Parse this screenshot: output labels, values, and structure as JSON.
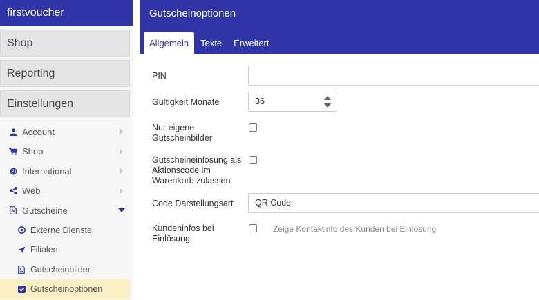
{
  "app": {
    "brand": "firstvoucher"
  },
  "sidebar": {
    "sections": [
      "Shop",
      "Reporting",
      "Einstellungen"
    ],
    "items": [
      {
        "label": "Account",
        "icon": "user-icon"
      },
      {
        "label": "Shop",
        "icon": "cart-icon"
      },
      {
        "label": "International",
        "icon": "globe-icon"
      },
      {
        "label": "Web",
        "icon": "share-icon"
      },
      {
        "label": "Gutscheine",
        "icon": "pdf-file-icon"
      }
    ],
    "subitems": [
      {
        "label": "Externe Dienste",
        "icon": "target-icon"
      },
      {
        "label": "Filialen",
        "icon": "location-arrow-icon"
      },
      {
        "label": "Gutscheinbilder",
        "icon": "image-file-icon"
      },
      {
        "label": "Gutscheinoptionen",
        "icon": "checked-square-icon",
        "active": true
      }
    ]
  },
  "header": {
    "title": "Gutscheinoptionen",
    "tabs": [
      "Allgemein",
      "Texte",
      "Erweitert"
    ],
    "active_tab": "Allgemein"
  },
  "form": {
    "pin": {
      "label": "PIN",
      "value": ""
    },
    "validity": {
      "label": "Gültigkeit Monate",
      "value": "36"
    },
    "own_images": {
      "label_line1": "Nur eigene",
      "label_line2": "Gutscheinbilder",
      "checked": false
    },
    "action_code": {
      "label_line1": "Gutscheineinlösung als",
      "label_line2": "Aktionscode im",
      "label_line3": "Warenkorb zulassen",
      "checked": false
    },
    "code_display": {
      "label": "Code Darstellungsart",
      "value": "QR Code"
    },
    "customer_info": {
      "label_line1": "Kundeninfos bei",
      "label_line2": "Einlösung",
      "hint": "Zeige Kontaktinfo des Kunden bei Einlösung",
      "checked": false
    }
  },
  "colors": {
    "primary": "#2f35a6",
    "active_bg": "#fbf0c4"
  }
}
